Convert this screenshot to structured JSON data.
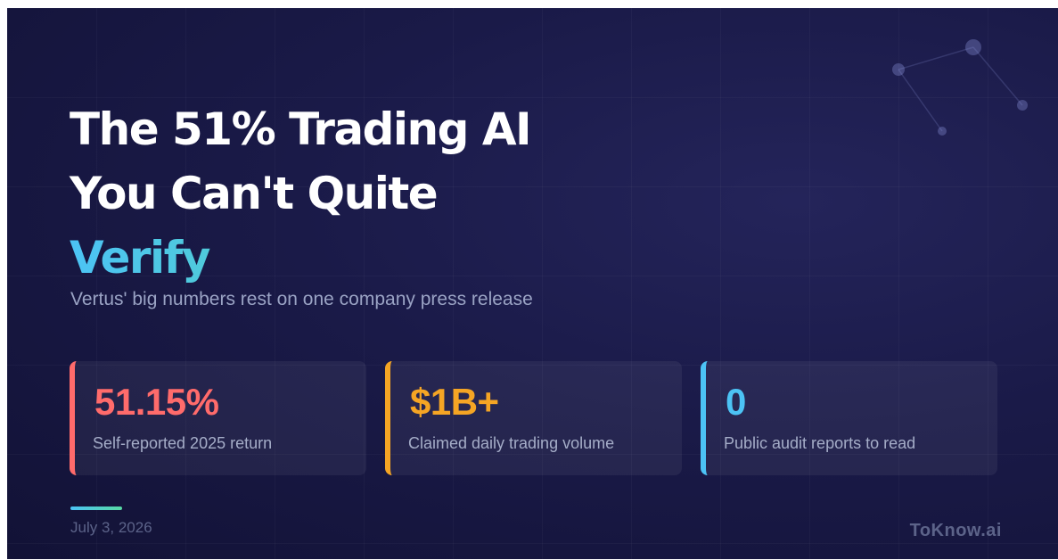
{
  "headline": {
    "line1": "The 51% Trading AI",
    "line2": "You Can't Quite",
    "accent": "Verify"
  },
  "subtitle": "Vertus' big numbers rest on one company press release",
  "stats": [
    {
      "value": "51.15%",
      "label": "Self-reported 2025 return",
      "color": "#ff6b6b"
    },
    {
      "value": "$1B+",
      "label": "Claimed daily trading volume",
      "color": "#f5a524"
    },
    {
      "value": "0",
      "label": "Public audit reports to read",
      "color": "#4cc3f5"
    }
  ],
  "footer": {
    "date": "July 3, 2026",
    "brand": "ToKnow.ai"
  },
  "colors": {
    "background": "#1a1a48",
    "accent_gradient_start": "#4cc3f5",
    "accent_gradient_end": "#6ee7a0"
  },
  "icons": {
    "decoration": "network-nodes-icon"
  }
}
